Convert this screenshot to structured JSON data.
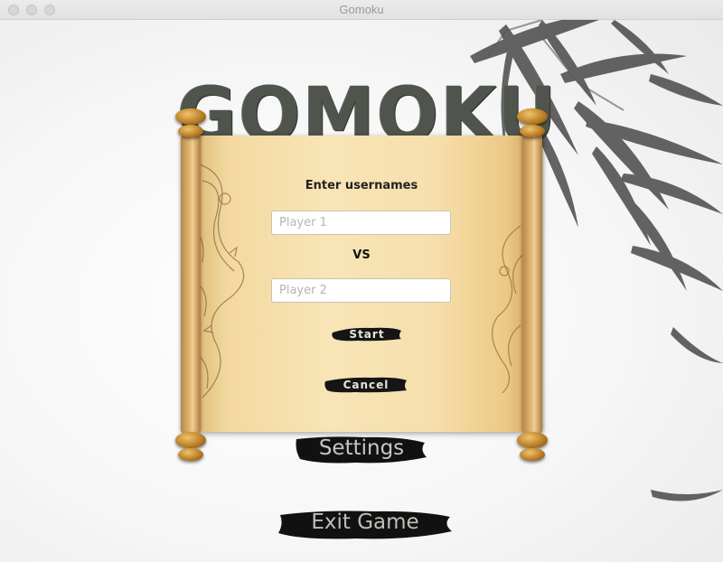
{
  "window": {
    "title": "Gomoku"
  },
  "game": {
    "title": "GOMOKU"
  },
  "dialog": {
    "heading": "Enter usernames",
    "player1": {
      "value": "",
      "placeholder": "Player 1"
    },
    "vs_label": "VS",
    "player2": {
      "value": "",
      "placeholder": "Player 2"
    },
    "start_label": "Start",
    "cancel_label": "Cancel"
  },
  "menu": {
    "settings_label": "Settings",
    "exit_label": "Exit Game"
  },
  "icons": {
    "window_controls": [
      "close-icon",
      "minimize-icon",
      "zoom-icon"
    ],
    "decor": [
      "bamboo-icon",
      "dragon-icon"
    ]
  },
  "colors": {
    "ink": "#111111",
    "title": "#4f544d",
    "paper": "#f6dfac",
    "brush_text": "#e4e7dd"
  }
}
